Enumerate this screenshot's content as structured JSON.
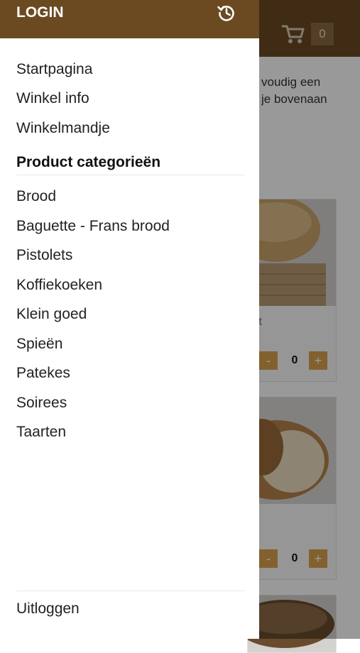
{
  "drawer": {
    "login_label": "LOGIN",
    "history_icon": "history-icon",
    "nav_items": [
      {
        "label": "Startpagina"
      },
      {
        "label": "Winkel info"
      },
      {
        "label": "Winkelmandje"
      }
    ],
    "categories_heading": "Product categorieën",
    "categories": [
      {
        "label": "Brood"
      },
      {
        "label": "Baguette - Frans brood"
      },
      {
        "label": "Pistolets"
      },
      {
        "label": "Koffiekoeken"
      },
      {
        "label": "Klein goed"
      },
      {
        "label": "Spieën"
      },
      {
        "label": "Patekes"
      },
      {
        "label": "Soirees"
      },
      {
        "label": "Taarten"
      }
    ],
    "logout_label": "Uitloggen"
  },
  "background": {
    "cart_icon": "cart-icon",
    "cart_count": "0",
    "intro_line_1": "voudig een",
    "intro_line_2": "je bovenaan",
    "cards": [
      {
        "caption": "it",
        "quantity": "0",
        "minus_label": "-",
        "plus_label": "+"
      },
      {
        "caption": "",
        "quantity": "0",
        "minus_label": "-",
        "plus_label": "+"
      }
    ]
  },
  "colors": {
    "header_brown": "#6b4a22",
    "button_accent": "#d9a24f",
    "overlay": "rgba(0,0,0,0.40)"
  }
}
